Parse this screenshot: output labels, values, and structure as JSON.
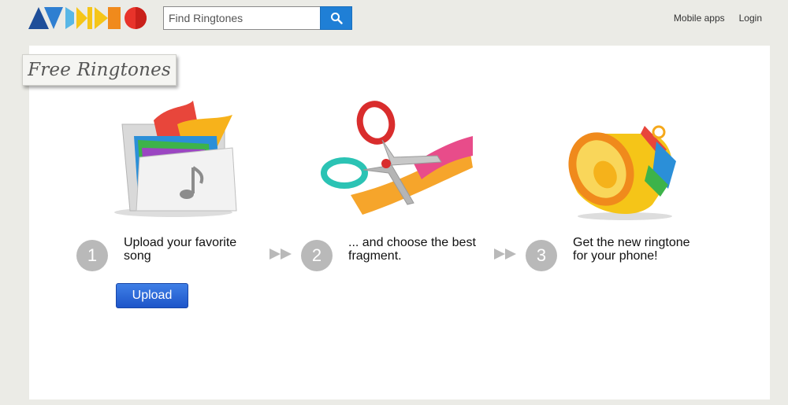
{
  "header": {
    "search": {
      "placeholder": "Find Ringtones",
      "value": ""
    },
    "links": {
      "mobile_apps": "Mobile apps",
      "login": "Login"
    }
  },
  "main": {
    "title": "Free Ringtones",
    "steps": [
      {
        "number": "1",
        "line1": "Upload your favorite",
        "line2": "song"
      },
      {
        "number": "2",
        "line1": "... and choose the best",
        "line2": "fragment."
      },
      {
        "number": "3",
        "line1": "Get the new ringtone",
        "line2": "for your phone!"
      }
    ],
    "upload_label": "Upload"
  },
  "icons": {
    "logo": "avidkid-logo",
    "search": "search-icon",
    "step1": "music-folder-icon",
    "step2": "scissors-icon",
    "step3": "bell-icon",
    "arrow": "double-arrow-icon"
  },
  "colors": {
    "page_bg": "#ebebe6",
    "search_button": "#1f7fd6",
    "upload_button": "#2962d6",
    "step_circle": "#b9b9b9"
  }
}
